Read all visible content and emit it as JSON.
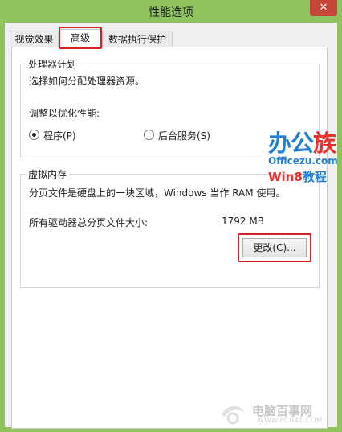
{
  "window": {
    "title": "性能选项",
    "close_label": "✕"
  },
  "tabs": [
    {
      "label": "视觉效果",
      "active": false
    },
    {
      "label": "高级",
      "active": true
    },
    {
      "label": "数据执行保护",
      "active": false
    }
  ],
  "processor": {
    "group_title": "处理器计划",
    "description": "选择如何分配处理器资源。",
    "adjust_label": "调整以优化性能:",
    "options": [
      {
        "label": "程序(P)",
        "selected": true
      },
      {
        "label": "后台服务(S)",
        "selected": false
      }
    ]
  },
  "virtual_memory": {
    "group_title": "虚拟内存",
    "description": "分页文件是硬盘上的一块区域，Windows 当作 RAM 使用。",
    "total_label": "所有驱动器总分页文件大小:",
    "total_value": "1792 MB",
    "change_button": "更改(C)..."
  },
  "overlay_logo": {
    "main_a": "办公",
    "main_b": "族",
    "site": "Officezu.com",
    "sub_a": "Win8",
    "sub_b": "教程"
  },
  "watermark": {
    "name": "电脑百事网",
    "url": "WWW.PC841.COM"
  },
  "colors": {
    "titlebar": "#8ec35e",
    "close_button": "#c7463a",
    "highlight": "#d6222a",
    "logo_blue": "#1f7fd6",
    "logo_red": "#e8322b"
  }
}
